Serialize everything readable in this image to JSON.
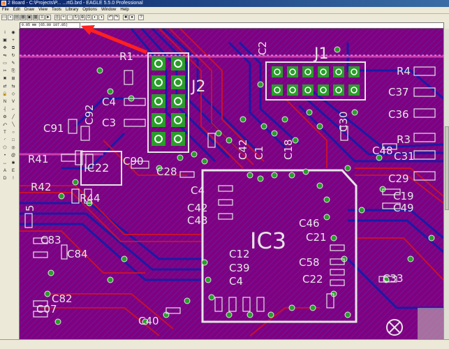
{
  "window": {
    "title": "2 Board - C:\\Projects\\P... ...rtG.brd - EAGLE 5.5.0 Professional"
  },
  "menu": [
    "File",
    "Edit",
    "Draw",
    "View",
    "Tools",
    "Library",
    "Options",
    "Window",
    "Help"
  ],
  "coordinates": "0.05 mm (65.80 107.85)",
  "labels": {
    "R1": "R1",
    "J2": "J2",
    "J1": "J1",
    "C2": "C2",
    "C4": "C4",
    "C3": "C3",
    "C92": "C92",
    "C91": "C91",
    "R41": "R41",
    "IC22": "IC22",
    "C90": "C90",
    "C28": "C28",
    "R42": "R42",
    "R44": "R44",
    "C83": "C83",
    "C84": "C84",
    "C82": "C82",
    "C07": "C07",
    "C40": "C40",
    "IC3": "IC3",
    "C4x": "C4",
    "C42": "C42",
    "C43": "C43",
    "C12": "C12",
    "C39": "C39",
    "C46": "C46",
    "C21": "C21",
    "C22": "C22",
    "C30": "C30",
    "C42r": "C42",
    "C18": "C18",
    "R4": "R4",
    "C37": "C37",
    "C36": "C36",
    "R3": "R3",
    "C31": "C31",
    "C29": "C29",
    "C48": "C48",
    "C19": "C19",
    "C49": "C49",
    "C33": "C33",
    "C58": "C58",
    "C1": "C1",
    "C5": "5",
    "C4b": "C4"
  },
  "colors": {
    "board": "#800080",
    "top_copper": "#c8102e",
    "bottom_copper": "#1a1aa6",
    "pad": "#2a9d2a",
    "silkscreen": "#e6e6e6",
    "arrow": "#ff2020"
  },
  "icons": {
    "sidebar": [
      "info-icon",
      "show-icon",
      "display-icon",
      "mark-icon",
      "move-icon",
      "copy-icon",
      "mirror-icon",
      "rotate-icon",
      "group-icon",
      "change-icon",
      "cut-icon",
      "paste-icon",
      "delete-icon",
      "add-icon",
      "pinswap-icon",
      "replace-icon",
      "lock-icon",
      "smash-icon",
      "name-icon",
      "value-icon",
      "split-icon",
      "miter-icon",
      "optimize-icon",
      "route-icon",
      "ripup-icon",
      "wire-icon",
      "text-icon",
      "circle-icon",
      "arc-icon",
      "rect-icon",
      "polygon-icon",
      "via-icon",
      "hole-icon",
      "attribute-icon",
      "dimension-icon",
      "ratsnest-icon",
      "auto-icon",
      "erc-icon",
      "drc-icon",
      "errors-icon"
    ]
  }
}
